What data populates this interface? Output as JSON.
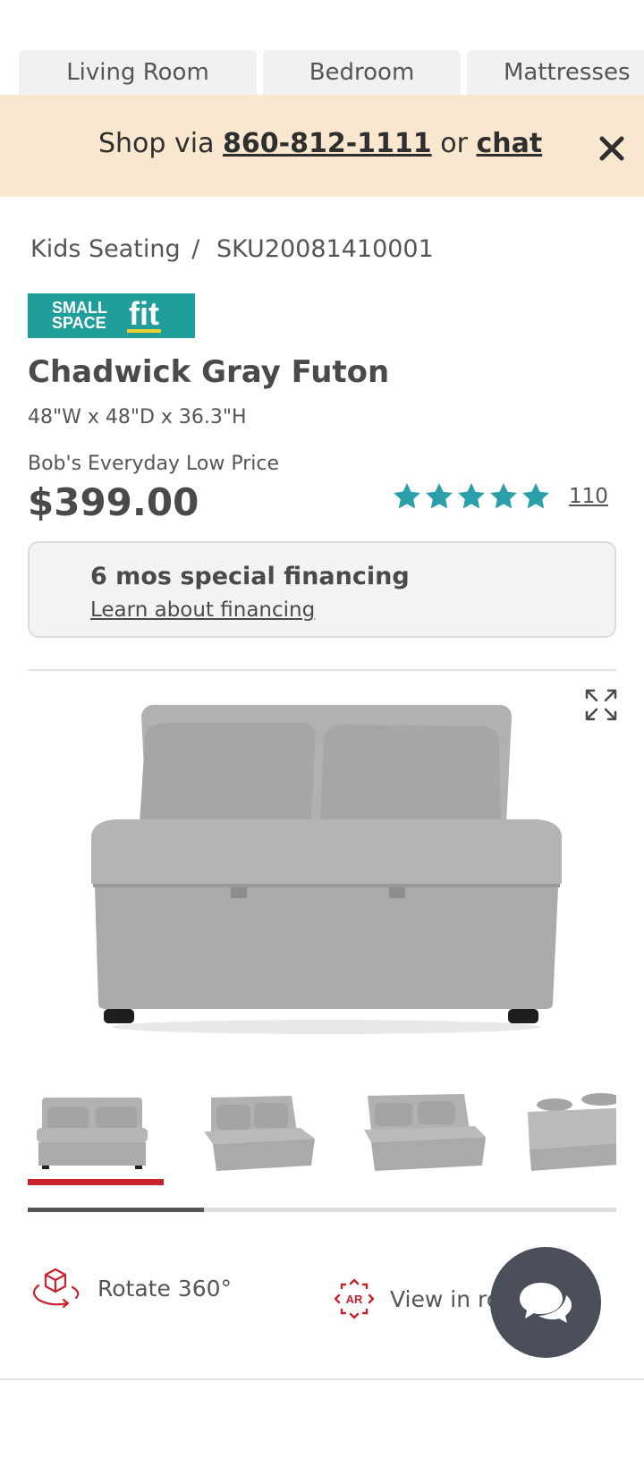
{
  "category_tabs": [
    "Living Room",
    "Bedroom",
    "Mattresses"
  ],
  "promo": {
    "prefix": "Shop via",
    "phone": "860-812-1111",
    "middle": "or",
    "chat": "chat"
  },
  "breadcrumb": {
    "category": "Kids Seating",
    "separator": "/",
    "sku": "SKU20081410001"
  },
  "badge": {
    "line1": "SMALL",
    "line2": "SPACE",
    "fit": "fit",
    "color": "#1f9e9b"
  },
  "product": {
    "title": "Chadwick Gray Futon",
    "dimensions": "48\"W x 48\"D x 36.3\"H",
    "price_label": "Bob's Everyday Low Price",
    "price": "$399.00",
    "rating": 5,
    "review_count": "110"
  },
  "financing": {
    "title": "6 mos special financing",
    "link": "Learn about financing"
  },
  "gallery": {
    "thumbnails": [
      "futon-front",
      "futon-angle",
      "futon-angle-right",
      "futon-bed-open"
    ],
    "active_index": 0,
    "scroll_progress": 0.3
  },
  "actions": {
    "rotate": "Rotate 360°",
    "view_in_room": "View in room",
    "ar_label": "AR"
  },
  "colors": {
    "accent_red": "#c8232c",
    "star_teal": "#2a9fa9",
    "promo_bg": "#f9e8cf",
    "chat_bg": "#4a4f59"
  }
}
